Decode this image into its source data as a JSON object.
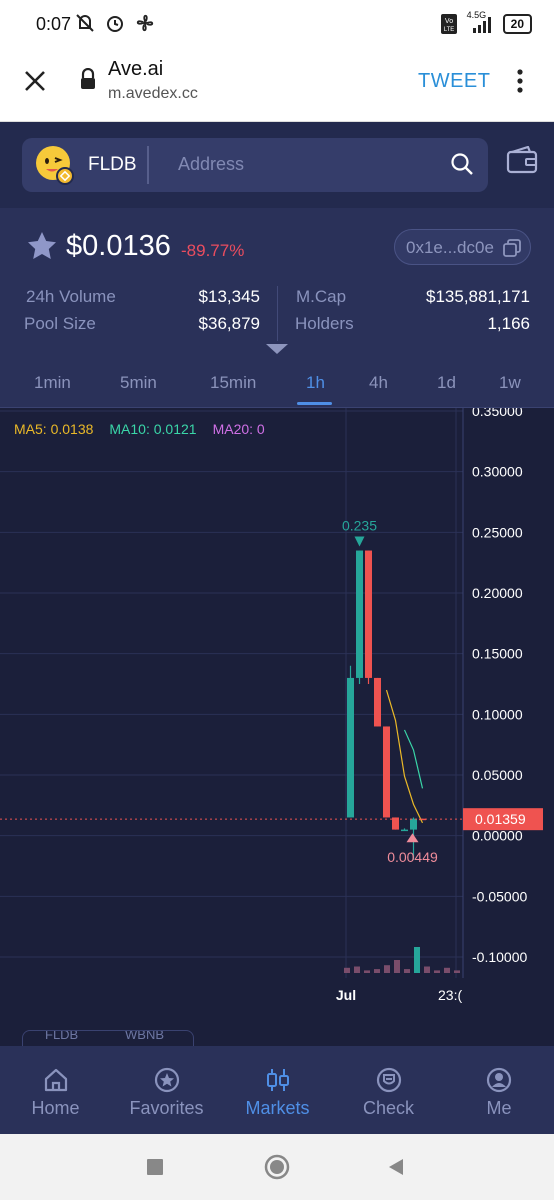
{
  "status_bar": {
    "time": "0:07",
    "network": "4.5G",
    "battery": "20",
    "icons": [
      "mute-icon",
      "alarm-icon",
      "fan-icon",
      "volte-icon",
      "signal-icon",
      "battery-icon"
    ]
  },
  "browser": {
    "title": "Ave.ai",
    "url": "m.avedex.cc",
    "tweet_label": "TWEET",
    "icons": [
      "close-icon",
      "lock-icon",
      "more-vert-icon"
    ]
  },
  "header": {
    "token_name": "FLDB",
    "search_placeholder": "Address"
  },
  "token": {
    "price": "$0.0136",
    "change": "-89.77%",
    "address_short": "0x1e...dc0e",
    "stats": {
      "volume_label": "24h Volume",
      "volume_value": "$13,345",
      "pool_label": "Pool Size",
      "pool_value": "$36,879",
      "mcap_label": "M.Cap",
      "mcap_value": "$135,881,171",
      "holders_label": "Holders",
      "holders_value": "1,166"
    }
  },
  "timeframes": [
    "1min",
    "5min",
    "15min",
    "1h",
    "4h",
    "1d",
    "1w"
  ],
  "active_timeframe": "1h",
  "ma_legend": {
    "ma5": "MA5: 0.0138",
    "ma10": "MA10: 0.0121",
    "ma20": "MA20: 0"
  },
  "pair_tabs": [
    "FLDB",
    "WBNB"
  ],
  "nav": [
    {
      "label": "Home",
      "icon": "home-icon"
    },
    {
      "label": "Favorites",
      "icon": "favorites-icon"
    },
    {
      "label": "Markets",
      "icon": "markets-icon"
    },
    {
      "label": "Check",
      "icon": "check-shield-icon"
    },
    {
      "label": "Me",
      "icon": "user-icon"
    }
  ],
  "active_nav": "Markets",
  "colors": {
    "up": "#26a69a",
    "down": "#ef5350",
    "accent": "#4f8fe6",
    "bg": "#1b1f3a"
  },
  "chart_data": {
    "type": "candlestick",
    "y_ticks": [
      "0.35000",
      "0.30000",
      "0.25000",
      "0.20000",
      "0.15000",
      "0.10000",
      "0.05000",
      "0.00000",
      "-0.05000",
      "-0.10000"
    ],
    "ylim": [
      -0.1,
      0.35
    ],
    "x_labels": [
      "Jul",
      "23:("
    ],
    "grid": true,
    "last_price": 0.01359,
    "last_price_label": "0.01359",
    "annotations": [
      {
        "text": "0.235",
        "value": 0.235,
        "marker": "high"
      },
      {
        "text": "0.00449",
        "value": 0.00449,
        "marker": "low"
      }
    ],
    "candles": [
      {
        "open": 0.015,
        "high": 0.14,
        "low": 0.015,
        "close": 0.13
      },
      {
        "open": 0.13,
        "high": 0.235,
        "low": 0.125,
        "close": 0.235
      },
      {
        "open": 0.235,
        "high": 0.235,
        "low": 0.125,
        "close": 0.13
      },
      {
        "open": 0.13,
        "high": 0.13,
        "low": 0.09,
        "close": 0.09
      },
      {
        "open": 0.09,
        "high": 0.09,
        "low": 0.015,
        "close": 0.015
      },
      {
        "open": 0.015,
        "high": 0.015,
        "low": 0.005,
        "close": 0.005
      },
      {
        "open": 0.005,
        "high": 0.006,
        "low": 0.00449,
        "close": 0.005
      },
      {
        "open": 0.005,
        "high": 0.015,
        "low": -0.02,
        "close": 0.014
      },
      {
        "open": 0.014,
        "high": 0.014,
        "low": 0.013,
        "close": 0.0136
      }
    ],
    "volume_relative": [
      0.2,
      0.25,
      0.1,
      0.15,
      0.3,
      0.5,
      0.15,
      1.0,
      0.25,
      0.1,
      0.2,
      0.1
    ]
  }
}
